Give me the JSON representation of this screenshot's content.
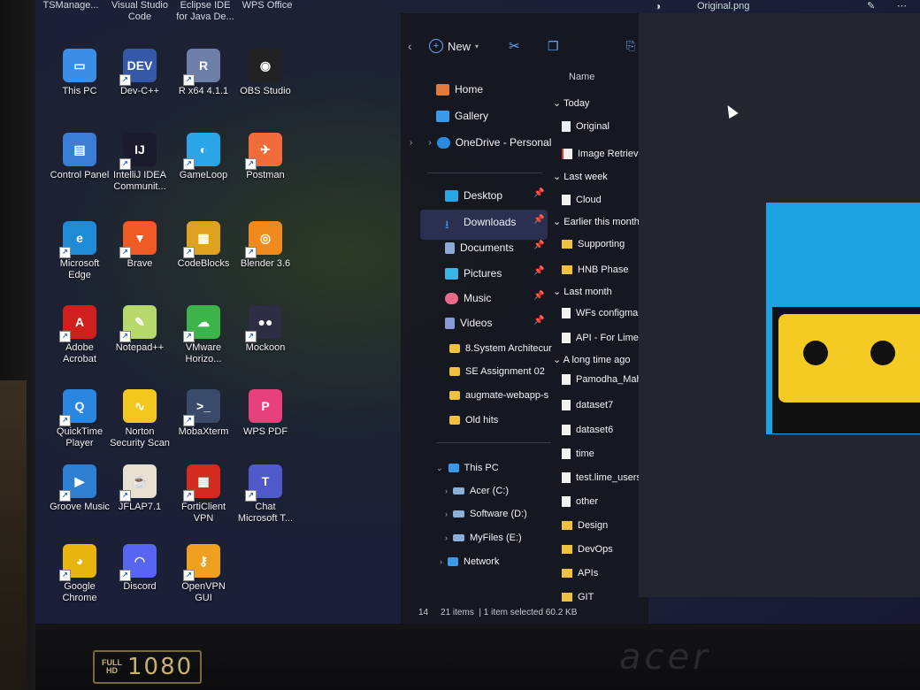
{
  "top_labels": [
    "TSManage...",
    "Visual Studio\nCode",
    "Eclipse IDE\nfor Java De...",
    "WPS Office"
  ],
  "desktop_icons": [
    {
      "label": "This PC",
      "color": "#3a8ee6",
      "glyph": "▭",
      "shortcut": false
    },
    {
      "label": "Dev-C++",
      "color": "#3558a8",
      "glyph": "DEV",
      "shortcut": true
    },
    {
      "label": "R x64 4.1.1",
      "color": "#6b7fa8",
      "glyph": "R",
      "shortcut": true
    },
    {
      "label": "OBS Studio",
      "color": "#222222",
      "glyph": "◉",
      "shortcut": false
    },
    {
      "label": "Control Panel",
      "color": "#3a7dd6",
      "glyph": "▤",
      "shortcut": false
    },
    {
      "label": "IntelliJ IDEA\nCommunit...",
      "color": "#1b1b2e",
      "glyph": "IJ",
      "shortcut": true
    },
    {
      "label": "GameLoop",
      "color": "#2aa6e8",
      "glyph": "◐",
      "shortcut": true
    },
    {
      "label": "Postman",
      "color": "#f26b3a",
      "glyph": "✈",
      "shortcut": true
    },
    {
      "label": "Microsoft\nEdge",
      "color": "#1f8ad6",
      "glyph": "e",
      "shortcut": true
    },
    {
      "label": "Brave",
      "color": "#f05a24",
      "glyph": "▼",
      "shortcut": true
    },
    {
      "label": "CodeBlocks",
      "color": "#e0a020",
      "glyph": "▦",
      "shortcut": true
    },
    {
      "label": "Blender 3.6",
      "color": "#f08a1c",
      "glyph": "◎",
      "shortcut": true
    },
    {
      "label": "Adobe\nAcrobat",
      "color": "#d0201e",
      "glyph": "A",
      "shortcut": true
    },
    {
      "label": "Notepad++",
      "color": "#b7d86a",
      "glyph": "✎",
      "shortcut": true
    },
    {
      "label": "VMware\nHorizo...",
      "color": "#3bb44a",
      "glyph": "☁",
      "shortcut": true
    },
    {
      "label": "Mockoon",
      "color": "#2d2d44",
      "glyph": "●●",
      "shortcut": true
    },
    {
      "label": "QuickTime\nPlayer",
      "color": "#2a86e0",
      "glyph": "Q",
      "shortcut": true
    },
    {
      "label": "Norton\nSecurity Scan",
      "color": "#f2c81e",
      "glyph": "∿",
      "shortcut": false
    },
    {
      "label": "MobaXterm",
      "color": "#3a4a6a",
      "glyph": ">_",
      "shortcut": true
    },
    {
      "label": "WPS PDF",
      "color": "#e8407a",
      "glyph": "P",
      "shortcut": false
    },
    {
      "label": "Groove Music",
      "color": "#2f7fd2",
      "glyph": "▶",
      "shortcut": true
    },
    {
      "label": "JFLAP7.1",
      "color": "#e8e0d0",
      "glyph": "☕",
      "shortcut": true
    },
    {
      "label": "FortiClient\nVPN",
      "color": "#d52b1e",
      "glyph": "▦",
      "shortcut": true
    },
    {
      "label": "Chat\nMicrosoft T...",
      "color": "#5059c9",
      "glyph": "T",
      "shortcut": true
    },
    {
      "label": "Google\nChrome",
      "color": "#e8b40e",
      "glyph": "◕",
      "shortcut": true
    },
    {
      "label": "Discord",
      "color": "#5865f2",
      "glyph": "◠",
      "shortcut": true
    },
    {
      "label": "OpenVPN\nGUI",
      "color": "#f0a020",
      "glyph": "⚷",
      "shortcut": true
    }
  ],
  "explorer": {
    "new_label": "New",
    "nav": {
      "home": "Home",
      "gallery": "Gallery",
      "onedrive": "OneDrive - Personal",
      "desktop": "Desktop",
      "downloads": "Downloads",
      "documents": "Documents",
      "pictures": "Pictures",
      "music": "Music",
      "videos": "Videos",
      "folder1": "8.System Architecur",
      "folder2": "SE Assignment 02",
      "folder3": "augmate-webapp-s",
      "folder4": "Old hits",
      "thispc": "This PC",
      "drive_c": "Acer (C:)",
      "drive_d": "Software (D:)",
      "drive_e": "MyFiles (E:)",
      "network": "Network"
    },
    "column_name": "Name",
    "groups": {
      "today": "Today",
      "last_week": "Last week",
      "earlier": "Earlier this month",
      "last_month": "Last month",
      "long_ago": "A long time ago"
    },
    "files": {
      "original": "Original",
      "image_retrieval": "Image Retrieva",
      "cloud": "Cloud",
      "supporting": "Supporting",
      "hnb": "HNB  Phase",
      "wfs": "WFs configmap",
      "api": "API - For Lime",
      "pamodha": "Pamodha_Maha",
      "dataset7": "dataset7",
      "dataset6": "dataset6",
      "time": "time",
      "testlime": "test.lime_users_",
      "other": "other",
      "design": "Design",
      "devops": "DevOps",
      "apis": "APIs",
      "git": "GIT"
    },
    "status": {
      "left": "14",
      "items": "21 items",
      "selected": "1 item selected  60.2 KB"
    }
  },
  "preview": {
    "title": "Original.png"
  },
  "bezel": {
    "fhd": "FULL\nHD",
    "resolution": "1080",
    "brand": "acer"
  }
}
